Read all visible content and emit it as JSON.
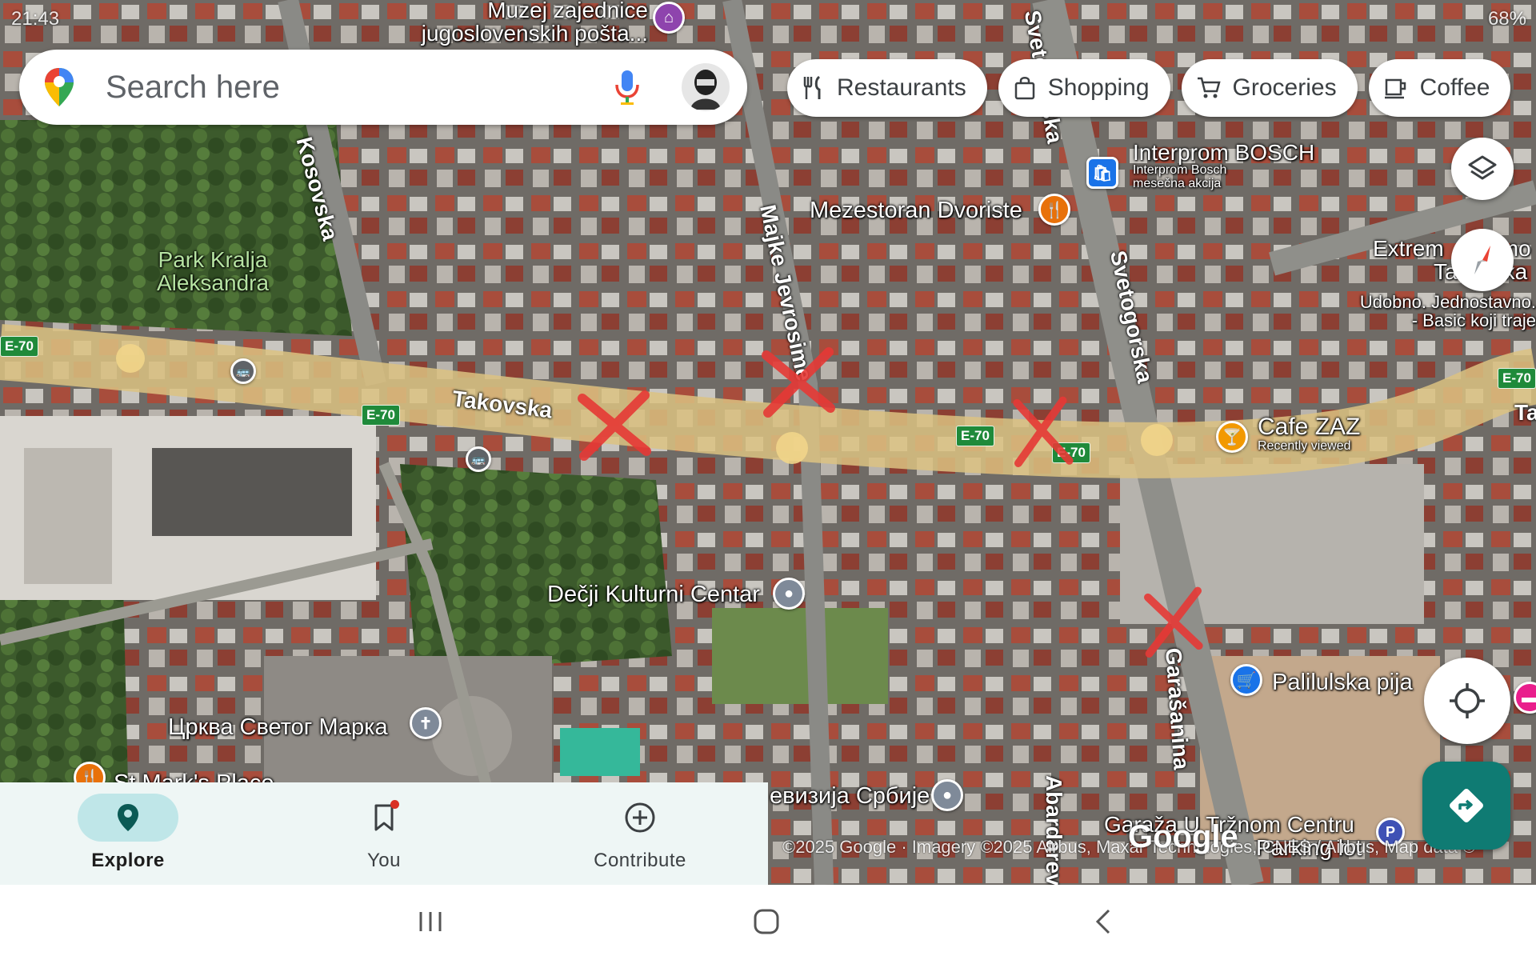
{
  "status_bar": {
    "time": "21:43",
    "battery": "68%"
  },
  "search": {
    "placeholder": "Search here"
  },
  "chips": [
    {
      "icon": "fork-knife-icon",
      "label": "Restaurants"
    },
    {
      "icon": "shopping-bag-icon",
      "label": "Shopping"
    },
    {
      "icon": "cart-icon",
      "label": "Groceries"
    },
    {
      "icon": "coffee-icon",
      "label": "Coffee"
    }
  ],
  "map": {
    "streets": {
      "takovska": "Takovska",
      "kosovska": "Kosovska",
      "majke_jevrosime": "Majke Jevrosime",
      "svetogorska": "Svetogorska",
      "svetogorska_top": "Svetogorska",
      "garasanina": "Garašanina",
      "abardareva": "Abardareva",
      "takovska_right": "Ta"
    },
    "road_shield": "E-70",
    "park": "Park Kralja Aleksandra",
    "pois": {
      "museum": "Muzej zajednice jugoslovenskih pošta...",
      "interprom_title": "Interprom BOSCH",
      "interprom_sub1": "Interprom Bosch",
      "interprom_sub2": "mesečna akcija",
      "mezestoran": "Mezestoran Dvoriste",
      "extreme": "Extrem",
      "extreme_tail": "mo",
      "extreme_line2": "Ta",
      "extreme_line2_tail": "ska",
      "extreme_desc1": "Udobno. Jednostavno.",
      "extreme_desc2": "- Basic koji traje",
      "cafe_zaz": "Cafe ZAZ",
      "cafe_zaz_sub": "Recently viewed",
      "decji_centar": "Dečji Kulturni Centar",
      "crkva": "Црква Светог Марка",
      "st_marks": "St Mark's Place",
      "rts": "евизија Србије",
      "palilulska": "Palilulska pija",
      "garaza": "Garaža U Tržnom Centru",
      "garaza_sub": "Parking lot"
    }
  },
  "attribution": "©2025 Google · Imagery ©2025 Airbus, Maxar Technologies, CNES / Airbus, Map data ©",
  "google_logo": "Google",
  "bottom_nav": {
    "items": [
      {
        "label": "Explore",
        "active": true
      },
      {
        "label": "You",
        "active": false
      },
      {
        "label": "Contribute",
        "active": false
      }
    ]
  },
  "colors": {
    "accent_teal": "#0f7b73",
    "nav_active_bg": "#bfe6e8",
    "road_yellow": "#e8c77a",
    "x_mark_red": "#e53935"
  }
}
